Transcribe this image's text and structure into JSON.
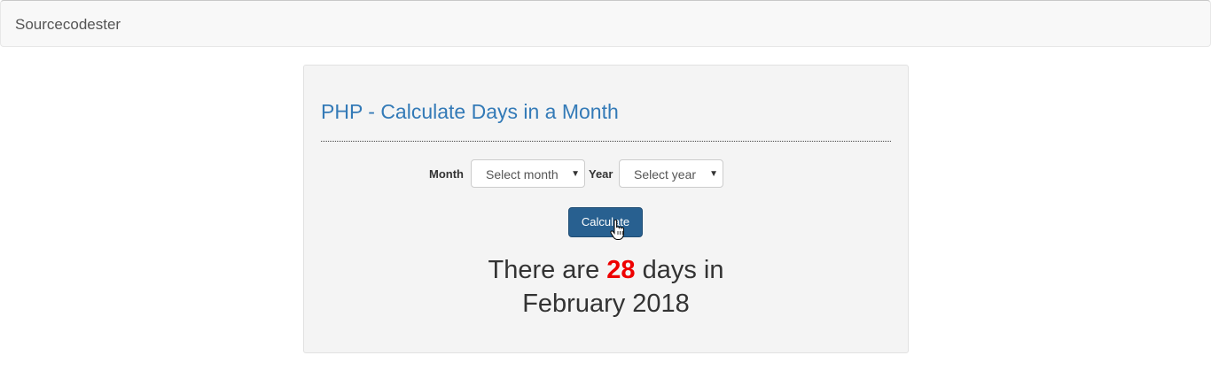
{
  "navbar": {
    "brand": "Sourcecodester"
  },
  "panel": {
    "title": "PHP - Calculate Days in a Month"
  },
  "form": {
    "month_label": "Month",
    "month_select_value": "Select month",
    "year_label": "Year",
    "year_select_value": "Select year",
    "submit_label": "Calculate"
  },
  "result": {
    "prefix": "There are",
    "days": "28",
    "suffix": "days in",
    "month_year": "February 2018"
  },
  "colors": {
    "title": "#337ab7",
    "button": "#286090",
    "days_highlight": "#ee0000"
  },
  "icons": {
    "select_caret": "caret-down-icon",
    "mouse_cursor": "hand-pointer-icon"
  }
}
